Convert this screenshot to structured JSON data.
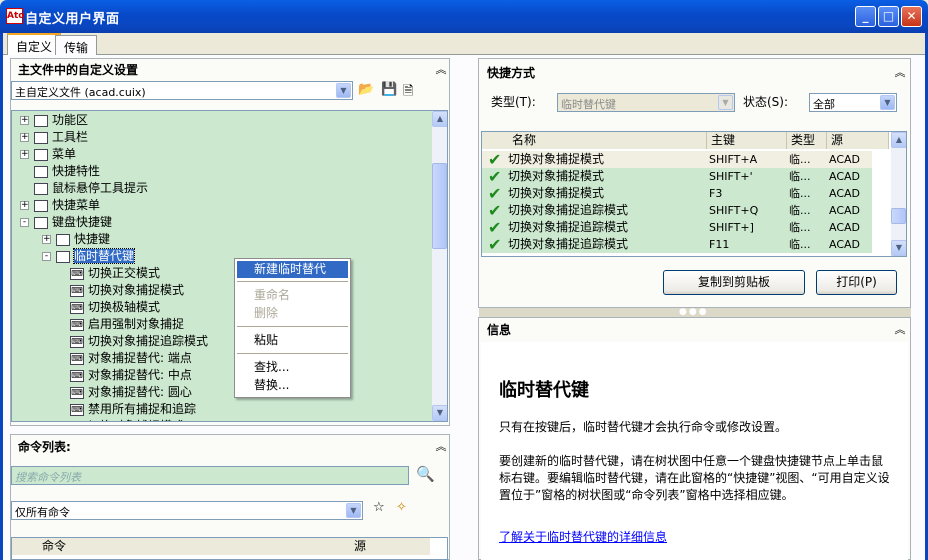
{
  "window": {
    "title": "自定义用户界面",
    "app_icon": "Ato"
  },
  "tabs": [
    {
      "label": "自定义",
      "active": true
    },
    {
      "label": "传输",
      "active": false
    }
  ],
  "left": {
    "header": "主文件中的自定义设置",
    "file_combo": "主自定义文件 (acad.cuix)",
    "tree": [
      {
        "label": "功能区",
        "toggle": "+",
        "icon": "folder-icon"
      },
      {
        "label": "工具栏",
        "toggle": "+",
        "icon": "toolbar-icon"
      },
      {
        "label": "菜单",
        "toggle": "+",
        "icon": "menu-icon"
      },
      {
        "label": "快捷特性",
        "toggle": "",
        "icon": "quick-properties-icon"
      },
      {
        "label": "鼠标悬停工具提示",
        "toggle": "",
        "icon": "rollover-tooltip-icon"
      },
      {
        "label": "快捷菜单",
        "toggle": "+",
        "icon": "shortcut-menu-icon"
      },
      {
        "label": "键盘快捷键",
        "toggle": "-",
        "icon": "keyboard-shortcuts-icon"
      },
      {
        "label": "快捷键",
        "toggle": "+",
        "icon": "shortcut-keys-icon"
      },
      {
        "label": "临时替代键",
        "toggle": "-",
        "icon": "temp-override-icon"
      },
      {
        "label": "切换正交模式",
        "toggle": "",
        "icon": "key-icon"
      },
      {
        "label": "切换对象捕捉模式",
        "toggle": "",
        "icon": "key-icon"
      },
      {
        "label": "切换极轴模式",
        "toggle": "",
        "icon": "key-icon"
      },
      {
        "label": "启用强制对象捕捉",
        "toggle": "",
        "icon": "key-icon"
      },
      {
        "label": "切换对象捕捉追踪模式",
        "toggle": "",
        "icon": "key-icon"
      },
      {
        "label": "对象捕捉替代: 端点",
        "toggle": "",
        "icon": "key-icon"
      },
      {
        "label": "对象捕捉替代: 中点",
        "toggle": "",
        "icon": "key-icon"
      },
      {
        "label": "对象捕捉替代: 圆心",
        "toggle": "",
        "icon": "key-icon"
      },
      {
        "label": "禁用所有捕捉和追踪",
        "toggle": "",
        "icon": "key-icon"
      },
      {
        "label": "切换对象捕捉模式",
        "toggle": "",
        "icon": "key-icon"
      }
    ],
    "context_menu": {
      "new": "新建临时替代",
      "rename": "重命名",
      "delete": "删除",
      "paste": "粘贴",
      "find": "查找...",
      "replace": "替换..."
    },
    "cmdlist": {
      "header": "命令列表:",
      "search_placeholder": "搜索命令列表",
      "filter": "仅所有命令",
      "col_command": "命令",
      "col_source": "源"
    }
  },
  "shortcuts": {
    "header": "快捷方式",
    "type_label": "类型(T):",
    "type_value": "临时替代键",
    "status_label": "状态(S):",
    "status_value": "全部",
    "columns": {
      "name": "名称",
      "key": "主键",
      "type": "类型",
      "source": "源"
    },
    "rows": [
      {
        "name": "切换对象捕捉模式",
        "key": "SHIFT+A",
        "type": "临...",
        "source": "ACAD"
      },
      {
        "name": "切换对象捕捉模式",
        "key": "SHIFT+'",
        "type": "临...",
        "source": "ACAD"
      },
      {
        "name": "切换对象捕捉模式",
        "key": "F3",
        "type": "临...",
        "source": "ACAD"
      },
      {
        "name": "切换对象捕捉追踪模式",
        "key": "SHIFT+Q",
        "type": "临...",
        "source": "ACAD"
      },
      {
        "name": "切换对象捕捉追踪模式",
        "key": "SHIFT+]",
        "type": "临...",
        "source": "ACAD"
      },
      {
        "name": "切换对象捕捉追踪模式",
        "key": "F11",
        "type": "临...",
        "source": "ACAD"
      }
    ],
    "copy_button": "复制到剪贴板",
    "print_button": "打印(P)"
  },
  "info": {
    "header": "信息",
    "title": "临时替代键",
    "p1": "只有在按键后，临时替代键才会执行命令或修改设置。",
    "p2": "要创建新的临时替代键，请在树状图中任意一个键盘快捷键节点上单击鼠标右键。要编辑临时替代键，请在此窗格的“快捷键”视图、“可用自定义设置位于”窗格的树状图或“命令列表”窗格中选择相应键。",
    "link": "了解关于临时替代键的详细信息"
  }
}
